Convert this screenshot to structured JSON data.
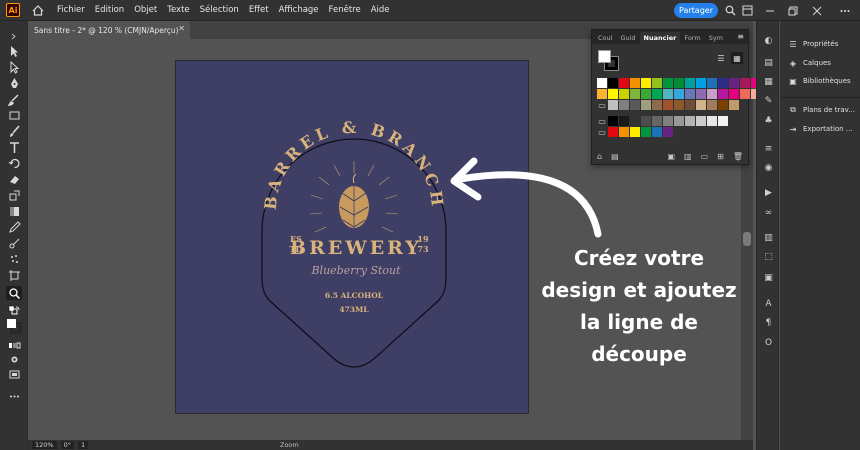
{
  "app": {
    "logo_text": "Ai",
    "menu": [
      "Fichier",
      "Edition",
      "Objet",
      "Texte",
      "Sélection",
      "Effet",
      "Affichage",
      "Fenêtre",
      "Aide"
    ],
    "share_label": "Partager"
  },
  "document": {
    "tab_title": "Sans titre - 2* @ 120 % (CMJN/Aperçu)"
  },
  "artwork": {
    "title_arc": "BARREL & BRANCH",
    "brewery": "BREWERY",
    "estd_left_top": "ES",
    "estd_left_bottom": "TD",
    "estd_right_top": "19",
    "estd_right_bottom": "73",
    "script_line": "Blueberry Stout",
    "alcohol": "6.5 ALCOHOL",
    "volume": "473ML",
    "colors": {
      "artboard": "#3f3f66",
      "gold": "#d9b47a",
      "outline": "#1a1a2e"
    }
  },
  "callout": {
    "lines": [
      "Créez votre",
      "design et ajoutez",
      "la ligne de",
      "découpe"
    ]
  },
  "swatches_panel": {
    "tabs": [
      "Coul",
      "Guid",
      "Nuancier",
      "Form",
      "Sym"
    ],
    "active_tab": "Nuancier",
    "rows": [
      [
        "#ffffff",
        "#000000",
        "#e30613",
        "#f39200",
        "#ffed00",
        "#95c11f",
        "#009640",
        "#008d36",
        "#00a19a",
        "#009fe3",
        "#1d71b8",
        "#2d2e83",
        "#662483",
        "#a3195b",
        "#e6007e",
        "#e94e1b"
      ],
      [
        "#f9b233",
        "#fff500",
        "#c8d400",
        "#7fb539",
        "#3aaa35",
        "#00a651",
        "#54b5bf",
        "#36a9e1",
        "#6879b5",
        "#8c6bb1",
        "#c89dc7",
        "#b5179e",
        "#e5007d",
        "#ec6a5c",
        "#f7a99a",
        "#fcc5c0"
      ],
      [
        "#c0c0c0",
        "#808080",
        "#5a5a5a",
        "#9e9e80",
        "#8c6a4a",
        "#a0522d",
        "#8b5a2b",
        "#6f4e37",
        "#d2b48c",
        "#a67b5b",
        "#7b3f00",
        "#c19a6b"
      ],
      [
        "#000000",
        "#1a1a1a",
        "#333333",
        "#4d4d4d",
        "#666666",
        "#808080",
        "#999999",
        "#b3b3b3",
        "#cccccc",
        "#e6e6e6",
        "#f2f2f2"
      ],
      [
        "#e30613",
        "#f39200",
        "#ffed00",
        "#009640",
        "#1d71b8",
        "#662483"
      ]
    ]
  },
  "right_panel": {
    "items": [
      "Propriétés",
      "Calques",
      "Bibliothèques",
      "Plans de trav...",
      "Exportation ..."
    ]
  },
  "statusbar": {
    "zoom": "120%",
    "rotation": "0°",
    "artboard_num": "1",
    "mode": "Zoom"
  }
}
